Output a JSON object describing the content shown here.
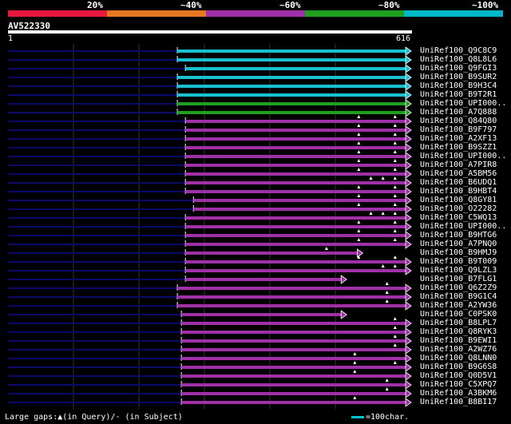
{
  "legend": {
    "segments": [
      {
        "label": "20%",
        "color": "#e8193c"
      },
      {
        "label": "~40%",
        "color": "#e87820"
      },
      {
        "label": "~60%",
        "color": "#a030a8"
      },
      {
        "label": "~80%",
        "color": "#20a020"
      },
      {
        "label": "~100%",
        "color": "#00b8c8"
      }
    ]
  },
  "query": {
    "name": "AV522330",
    "start": "1",
    "end": "616"
  },
  "footer": {
    "gaps_text": "Large gaps:▲(in Query)/- (in Subject)",
    "scale_text": "=100char."
  },
  "colors": {
    "cyan": "#18c0d0",
    "green": "#20a020",
    "magenta": "#a030a8",
    "dark": "#0a0a6a"
  },
  "hits": [
    {
      "label": "UniRef100_Q9C8C9",
      "color": "cyan",
      "start": 0.42,
      "end": 1.0,
      "gaps": []
    },
    {
      "label": "UniRef100_Q8L8L6",
      "color": "cyan",
      "start": 0.42,
      "end": 1.0,
      "gaps": []
    },
    {
      "label": "UniRef100_Q9FGI3",
      "color": "cyan",
      "start": 0.44,
      "end": 1.0,
      "gaps": []
    },
    {
      "label": "UniRef100_B9SUR2",
      "color": "cyan",
      "start": 0.42,
      "end": 1.0,
      "gaps": []
    },
    {
      "label": "UniRef100_B9H3C4",
      "color": "cyan",
      "start": 0.42,
      "end": 1.0,
      "gaps": []
    },
    {
      "label": "UniRef100_B9T2R1",
      "color": "cyan",
      "start": 0.42,
      "end": 1.0,
      "gaps": []
    },
    {
      "label": "UniRef100_UPI000..",
      "color": "green",
      "start": 0.42,
      "end": 1.0,
      "gaps": []
    },
    {
      "label": "UniRef100_A7Q888",
      "color": "green",
      "start": 0.42,
      "end": 1.0,
      "gaps": []
    },
    {
      "label": "UniRef100_Q84Q80",
      "color": "magenta",
      "start": 0.44,
      "end": 1.0,
      "gaps": [
        0.87,
        0.96
      ]
    },
    {
      "label": "UniRef100_B9F797",
      "color": "magenta",
      "start": 0.44,
      "end": 1.0,
      "gaps": [
        0.87,
        0.96
      ]
    },
    {
      "label": "UniRef100_A2XF13",
      "color": "magenta",
      "start": 0.44,
      "end": 1.0,
      "gaps": [
        0.87,
        0.96
      ]
    },
    {
      "label": "UniRef100_B9SZZ1",
      "color": "magenta",
      "start": 0.44,
      "end": 1.0,
      "gaps": [
        0.87,
        0.96
      ]
    },
    {
      "label": "UniRef100_UPI000..",
      "color": "magenta",
      "start": 0.44,
      "end": 1.0,
      "gaps": [
        0.87,
        0.96
      ]
    },
    {
      "label": "UniRef100_A7PIR8",
      "color": "magenta",
      "start": 0.44,
      "end": 1.0,
      "gaps": [
        0.87,
        0.96
      ]
    },
    {
      "label": "UniRef100_A5BM56",
      "color": "magenta",
      "start": 0.44,
      "end": 1.0,
      "gaps": [
        0.87,
        0.96
      ]
    },
    {
      "label": "UniRef100_B6UDQ1",
      "color": "magenta",
      "start": 0.44,
      "end": 1.0,
      "gaps": [
        0.9,
        0.93,
        0.96
      ]
    },
    {
      "label": "UniRef100_B9HBT4",
      "color": "magenta",
      "start": 0.44,
      "end": 1.0,
      "gaps": [
        0.87,
        0.96
      ]
    },
    {
      "label": "UniRef100_Q8GY81",
      "color": "magenta",
      "start": 0.46,
      "end": 1.0,
      "gaps": [
        0.87,
        0.96
      ]
    },
    {
      "label": "UniRef100_O22282",
      "color": "magenta",
      "start": 0.46,
      "end": 1.0,
      "gaps": [
        0.87,
        0.96
      ]
    },
    {
      "label": "UniRef100_C5WQ13",
      "color": "magenta",
      "start": 0.44,
      "end": 1.0,
      "gaps": [
        0.9,
        0.93,
        0.96
      ]
    },
    {
      "label": "UniRef100_UPI000..",
      "color": "magenta",
      "start": 0.44,
      "end": 1.0,
      "gaps": [
        0.87,
        0.96
      ]
    },
    {
      "label": "UniRef100_B9HTG6",
      "color": "magenta",
      "start": 0.44,
      "end": 1.0,
      "gaps": [
        0.87,
        0.96
      ]
    },
    {
      "label": "UniRef100_A7PNQ0",
      "color": "magenta",
      "start": 0.44,
      "end": 1.0,
      "gaps": [
        0.87,
        0.96
      ]
    },
    {
      "label": "UniRef100_B9HMJ9",
      "color": "magenta",
      "start": 0.44,
      "end": 0.88,
      "gaps": [
        0.79
      ]
    },
    {
      "label": "UniRef100_B9T009",
      "color": "magenta",
      "start": 0.44,
      "end": 1.0,
      "gaps": [
        0.87,
        0.96
      ]
    },
    {
      "label": "UniRef100_Q9LZL3",
      "color": "magenta",
      "start": 0.44,
      "end": 1.0,
      "gaps": [
        0.93,
        0.96
      ]
    },
    {
      "label": "UniRef100_B7FLG1",
      "color": "magenta",
      "start": 0.44,
      "end": 0.84,
      "gaps": []
    },
    {
      "label": "UniRef100_Q6Z2Z9",
      "color": "magenta",
      "start": 0.42,
      "end": 1.0,
      "gaps": [
        0.94
      ]
    },
    {
      "label": "UniRef100_B9G1C4",
      "color": "magenta",
      "start": 0.42,
      "end": 1.0,
      "gaps": [
        0.94
      ]
    },
    {
      "label": "UniRef100_A2YW36",
      "color": "magenta",
      "start": 0.42,
      "end": 1.0,
      "gaps": [
        0.94
      ]
    },
    {
      "label": "UniRef100_C0PSK0",
      "color": "magenta",
      "start": 0.43,
      "end": 0.84,
      "gaps": []
    },
    {
      "label": "UniRef100_B8LPL7",
      "color": "magenta",
      "start": 0.43,
      "end": 1.0,
      "gaps": [
        0.96
      ]
    },
    {
      "label": "UniRef100_Q8RYK3",
      "color": "magenta",
      "start": 0.43,
      "end": 1.0,
      "gaps": [
        0.96
      ]
    },
    {
      "label": "UniRef100_B9EWI1",
      "color": "magenta",
      "start": 0.43,
      "end": 1.0,
      "gaps": [
        0.96
      ]
    },
    {
      "label": "UniRef100_A2WZ76",
      "color": "magenta",
      "start": 0.43,
      "end": 1.0,
      "gaps": [
        0.96
      ]
    },
    {
      "label": "UniRef100_Q8LNN0",
      "color": "magenta",
      "start": 0.43,
      "end": 1.0,
      "gaps": [
        0.86
      ]
    },
    {
      "label": "UniRef100_B9G6S8",
      "color": "magenta",
      "start": 0.43,
      "end": 1.0,
      "gaps": [
        0.86,
        0.96
      ]
    },
    {
      "label": "UniRef100_Q0D5V1",
      "color": "magenta",
      "start": 0.43,
      "end": 1.0,
      "gaps": [
        0.86
      ]
    },
    {
      "label": "UniRef100_C5XPQ7",
      "color": "magenta",
      "start": 0.43,
      "end": 1.0,
      "gaps": [
        0.94
      ]
    },
    {
      "label": "UniRef100_A3BKM6",
      "color": "magenta",
      "start": 0.43,
      "end": 1.0,
      "gaps": [
        0.94
      ]
    },
    {
      "label": "UniRef100_B8BI17",
      "color": "magenta",
      "start": 0.43,
      "end": 1.0,
      "gaps": [
        0.86
      ]
    }
  ]
}
